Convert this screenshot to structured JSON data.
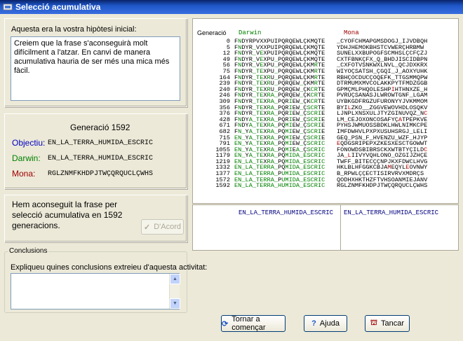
{
  "window": {
    "title": "Selecció acumulativa"
  },
  "hypothesis": {
    "label": "Aquesta era la vostra hipòtesi inicial:",
    "text": "Creiem que la frase s'aconseguirà molt difícilment a l'atzar. En canvi de manera acumulativa hauria de ser més una mica més fàcil."
  },
  "summary": {
    "generation_title": "Generació 1592",
    "objective_label": "Objectiu:",
    "objective_value": "EN_LA_TERRA_HUMIDA_ESCRIC",
    "darwin_label": "Darwin:",
    "darwin_value": "EN_LA_TERRA_HUMIDA_ESCRIC",
    "mona_label": "Mona:",
    "mona_value": "RGLZNMFKHDPJTWÇQRQUCLÇWHS",
    "colors": {
      "objective": "#0000C0",
      "darwin": "#008000",
      "mona": "#A00000"
    }
  },
  "result": {
    "message": "Hem aconseguit la frase per selecció acumulativa en 1592 generacions.",
    "agree_button": "D'Acord"
  },
  "conclusions": {
    "group_label": "Conclusions",
    "prompt": "Expliqueu quines conclusions extreieu d'aquesta activitat:",
    "value": ""
  },
  "table": {
    "headers": {
      "generation": "Generació",
      "darwin": "Darwin",
      "mona": "Mona"
    },
    "rows": [
      {
        "g": "0",
        "d": "FNDYRPVXXPUIPQRQEWLÇKMQTE",
        "m": "_CYOFCHMAPGMSDOGJ_IJVDBQH"
      },
      {
        "g": "5",
        "d": "FNDYR_VXXPUIPQRQEWLÇKMQTE",
        "m": "YDHJHEMOKBHSTCVWERÇHRBMW"
      },
      {
        "g": "12",
        "d": "FNDYR_VEXPUIPQRQEWLÇKMQTE",
        "m": "SUNELXXBUPOGFSCMHSLÇCFÇZJ"
      },
      {
        "g": "49",
        "d": "FNDYR_VEXPU_PQRQEWLÇKMQTE",
        "m": "CXTFBNKÇFX_Q_BHDJISCIDBPN"
      },
      {
        "g": "56",
        "d": "FNDYR_VEXPU_PQRQEWLÇKMRTE",
        "m": "_CXFOTVSNKWXLNVL_QCJDXKRX"
      },
      {
        "g": "75",
        "d": "FNDYR_TEXPU_PQRQEWLÇKMRTE",
        "m": "WIYOÇSATSH_ÇGQI_J_AOXYUHK"
      },
      {
        "g": "164",
        "d": "FNDYR_TEXRU_PQRQEWLÇKMRTE",
        "m": "RBHÇOCDUCÇOQEFK_TTGSMMQPW"
      },
      {
        "g": "239",
        "d": "FNDYR_TEXRU_PQRQEW_ÇKMRTE",
        "m": "DTRMUMXMVCOLAKKPYTFMDZGGB"
      },
      {
        "g": "240",
        "d": "FNDYR_TEXRU_PQRQEW_ÇKCRTE",
        "m": "GPMÇMLPHQOLESHPIHTHNXZE_H"
      },
      {
        "g": "246",
        "d": "FNDYR_TEXRA_PQRQEW_ÇKCRTE",
        "m": "PVRUÇSANASJLWROWTGNF_LGAM"
      },
      {
        "g": "309",
        "d": "FNDYR_TEXRA_PQRIEW_ÇKCRTE",
        "m": "UYBKGDFRGZUFURONYYJVKMMOM"
      },
      {
        "g": "356",
        "d": "FNDYR_TEXRA_PQRIEW_ÇSCRTE",
        "m": "BYILZKO__ZGGVEWOVHDLOSQKV"
      },
      {
        "g": "376",
        "d": "FNDYR_TEXRA_PQRIEW_ÇSCRIE",
        "m": "LJNPLXNSXULJTYZGINUVQZ_NC"
      },
      {
        "g": "428",
        "d": "FNDYA_TEXRA_PQRIEW_ÇSCRIE",
        "m": "LM_CEJOXONCOSAFYÇATPEPKVE"
      },
      {
        "g": "671",
        "d": "FNDYA_TEXRA_PQMIEW_ÇSCRIE",
        "m": "PYHSJWMUOSSBDKLHWLNIMKCPE"
      },
      {
        "g": "682",
        "d": "FN_YA_TEXRA_PQMIEW_ÇSCRIE",
        "m": "IMFDWHVLPXPXUSUHSRGJ_LELI"
      },
      {
        "g": "715",
        "d": "EN_YA_TEXRA_PQMIEW_ÇSCRIE",
        "m": "GEQ_PSN_F_HVENZU_WZF_HJYP"
      },
      {
        "g": "791",
        "d": "EN_YA_TEXRA_PQMIEW_ÇSCRIC",
        "m": "EQDGSRIPEPXZKESXESCTGOWWT"
      },
      {
        "g": "1055",
        "d": "EN_YA_TEXRA_PQMIEA_ÇSCRIC",
        "m": "FONOWDSBIBRSCKXWTBTYÇILDC"
      },
      {
        "g": "1179",
        "d": "EN_YA_TEXRA_PQMIDA_ESCRIC",
        "m": "JA_LIIVYVQHLONO_OZGIJZHÇE"
      },
      {
        "g": "1219",
        "d": "EN_LA_TEXRA_PQMIDA_ESCRIC",
        "m": "TWFF_BITECÇÇNPJKXFDWCLHVG"
      },
      {
        "g": "1332",
        "d": "EN_LA_TERRA_PQMIDA_ESCRIC",
        "m": "HKLBLHFGGKCBJAMEQYLEOVNWY"
      },
      {
        "g": "1377",
        "d": "EN_LA_TERRA_PUMIDA_ESCRIC",
        "m": "B_RPWLÇÇECTISIRVRVXMDRÇS"
      },
      {
        "g": "1572",
        "d": "EN_LA_TERRA_PUMIDA_ESCRIC",
        "m": "QODHXHKTHZFTVHSOANMIEJANV"
      },
      {
        "g": "1592",
        "d": "EN_LA_TERRA_HUMIDA_ESCRIC",
        "m": "RGLZNMFKHDPJTWÇQRQUCLÇWHS"
      }
    ],
    "final_darwin": "EN_LA_TERRA_HUMIDA_ESCRIC",
    "final_objective": "EN_LA_TERRA_HUMIDA_ESCRIC"
  },
  "buttons": {
    "restart": "Tornar a començar",
    "help": "Ajuda",
    "close": "Tancar"
  }
}
